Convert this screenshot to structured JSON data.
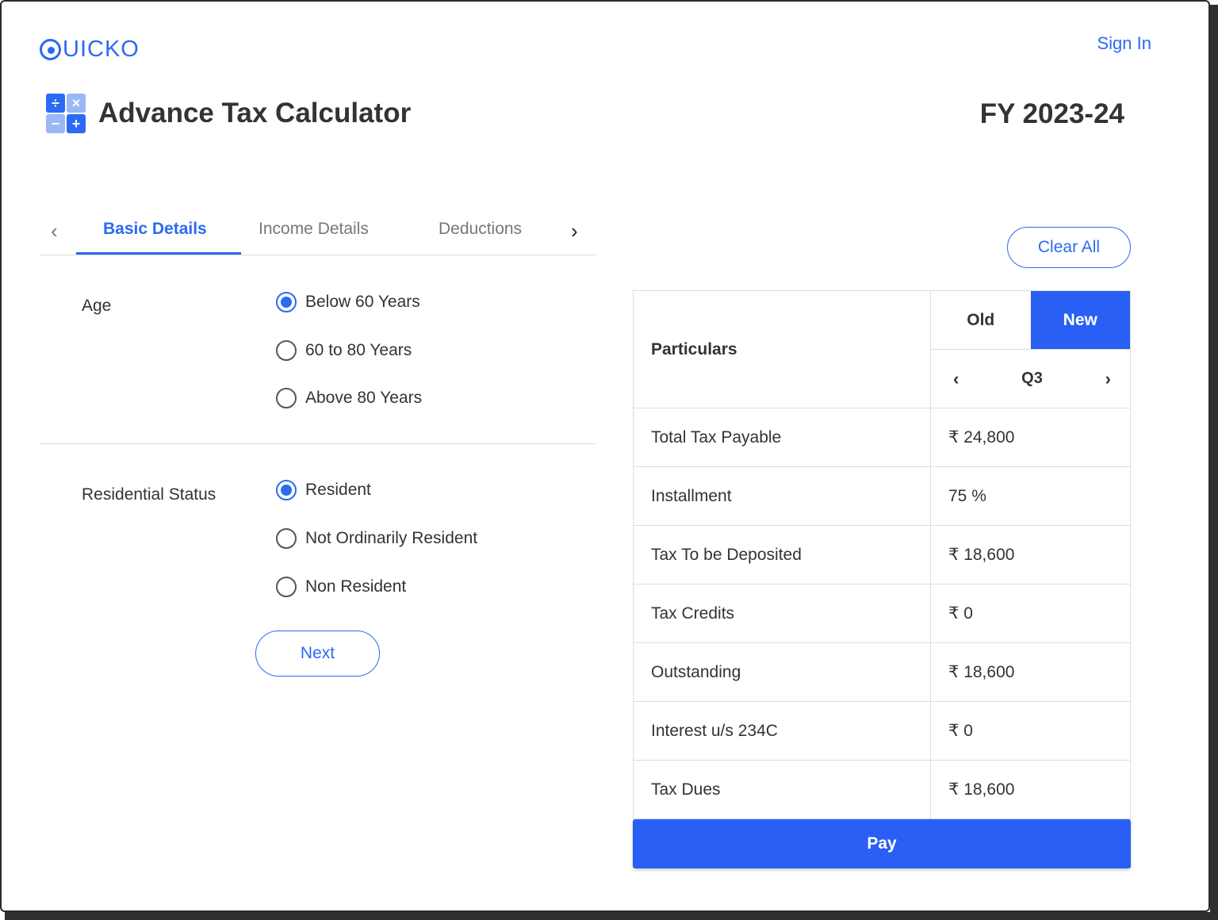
{
  "header": {
    "logo_text": "UICKO",
    "sign_in": "Sign In",
    "page_title": "Advance Tax Calculator",
    "fiscal_year": "FY 2023-24"
  },
  "tabs": {
    "items": [
      "Basic Details",
      "Income Details",
      "Deductions"
    ],
    "active": "Basic Details"
  },
  "age": {
    "label": "Age",
    "options": [
      "Below 60 Years",
      "60 to 80 Years",
      "Above 80 Years"
    ],
    "selected": "Below 60 Years"
  },
  "residential": {
    "label": "Residential Status",
    "options": [
      "Resident",
      "Not Ordinarily Resident",
      "Non Resident"
    ],
    "selected": "Resident"
  },
  "buttons": {
    "next": "Next",
    "clear_all": "Clear All",
    "pay": "Pay"
  },
  "summary": {
    "header_label": "Particulars",
    "regime_old": "Old",
    "regime_new": "New",
    "selected_regime": "New",
    "quarter": "Q3",
    "rows": [
      {
        "label": "Total Tax Payable",
        "value": "₹ 24,800"
      },
      {
        "label": "Installment",
        "value": "75 %"
      },
      {
        "label": "Tax To be Deposited",
        "value": "₹ 18,600"
      },
      {
        "label": "Tax Credits",
        "value": "₹ 0"
      },
      {
        "label": "Outstanding",
        "value": "₹ 18,600"
      },
      {
        "label": "Interest u/s 234C",
        "value": "₹ 0"
      },
      {
        "label": "Tax Dues",
        "value": "₹ 18,600"
      }
    ]
  },
  "colors": {
    "brand": "#2a6bf2",
    "primary_button": "#2a5ff5"
  }
}
